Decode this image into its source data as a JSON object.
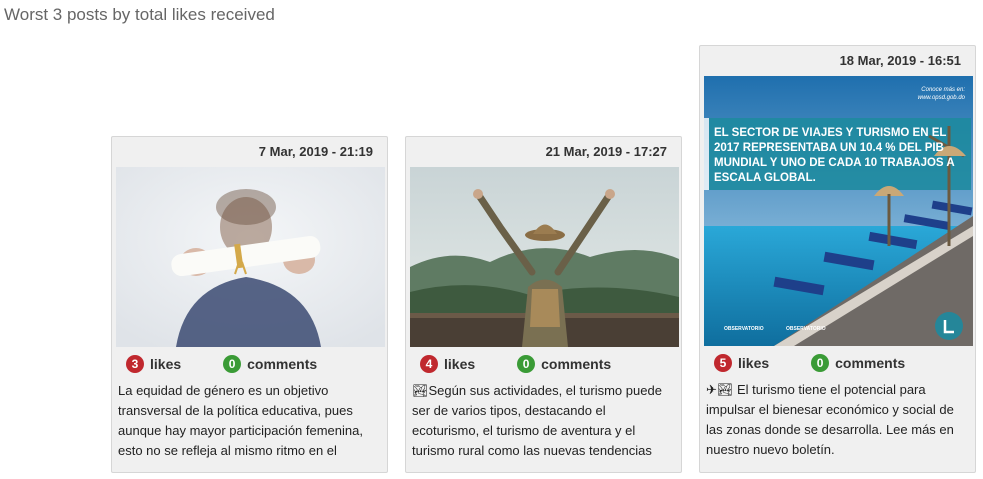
{
  "header": {
    "title": "Worst 3 posts by total likes received"
  },
  "posts": [
    {
      "date": "7 Mar, 2019 - 21:19",
      "likes": "3",
      "likes_label": "likes",
      "comments": "0",
      "comments_label": "comments",
      "caption": "La equidad de género es un objetivo transversal de la política educativa, pues aunque hay mayor participación femenina, esto no se refleja al mismo ritmo en el"
    },
    {
      "date": "21 Mar, 2019 - 17:27",
      "likes": "4",
      "likes_label": "likes",
      "comments": "0",
      "comments_label": "comments",
      "caption": "🏞Según sus actividades, el turismo puede ser de varios tipos, destacando el ecoturismo, el turismo de aventura y el turismo rural como las nuevas tendencias"
    },
    {
      "date": "18 Mar, 2019 - 16:51",
      "likes": "5",
      "likes_label": "likes",
      "comments": "0",
      "comments_label": "comments",
      "caption": "✈🏞 El turismo tiene el potencial para impulsar el bienesar económico y social de las zonas donde se desarrolla. Lee más en nuestro nuevo boletín.",
      "image_text": {
        "headline": "EL SECTOR DE VIAJES Y TURISMO EN EL 2017 REPRESENTABA UN 10.4 % DEL PIB MUNDIAL Y UNO DE CADA 10 TRABAJOS A ESCALA GLOBAL.",
        "corner": "Conoce más en: www.opsd.gob.do",
        "logo_left": "OBSERVATORIO",
        "logo_right": "OBSERVATORIO"
      }
    }
  ],
  "colors": {
    "likes_badge": "#c0282e",
    "comments_badge": "#3a9b36"
  }
}
